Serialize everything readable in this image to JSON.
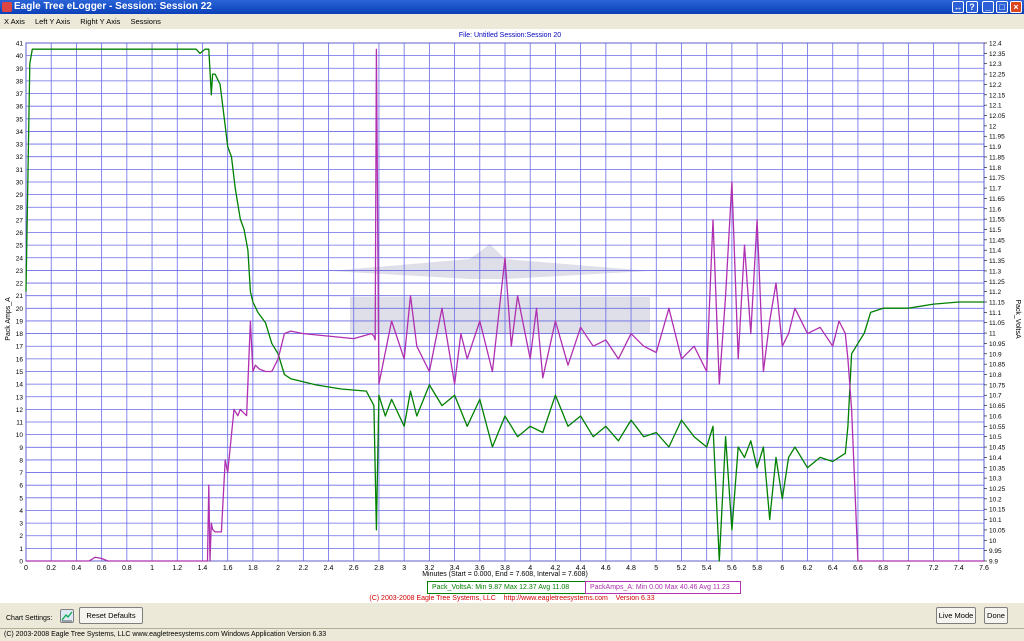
{
  "window": {
    "title": "Eagle Tree eLogger - Session: Session 22"
  },
  "menu": {
    "items": [
      {
        "label": "X Axis",
        "key": "X"
      },
      {
        "label": "Left Y Axis",
        "key": "L"
      },
      {
        "label": "Right Y Axis",
        "key": "R"
      },
      {
        "label": "Sessions",
        "key": ""
      }
    ]
  },
  "chart_header": {
    "file_line": "File: Untitled   Session:Session 20"
  },
  "footer": {
    "copyright": "(C) 2003-2008 Eagle Tree Systems, LLC",
    "url": "http://www.eagletreesystems.com",
    "version": "Version 6.33",
    "chart_settings_label": "Chart Settings:",
    "reset_label": "Reset Defaults",
    "live_mode_label": "Live Mode",
    "done_label": "Done",
    "status_text": "(C) 2003-2008 Eagle Tree Systems, LLC    www.eagletreesystems.com    Windows Application Version 6.33"
  },
  "colors": {
    "volts": "#008000",
    "amps": "#b030b0",
    "grid": "#6a6ae8",
    "title": "#0000c0",
    "footer_red": "#d00000"
  },
  "chart_data": {
    "type": "line",
    "title": "",
    "xlabel": "Minutes (Start = 0.000,  End = 7.608,  Interval = 7.608)",
    "ylabel_left": "Pack Amps_A",
    "ylabel_right": "Pack_VoltsA",
    "xlim": [
      0,
      7.6
    ],
    "ylim_left": [
      0,
      41
    ],
    "ylim_right": [
      9.9,
      12.4
    ],
    "x_ticks": [
      "0",
      "0.2",
      "0.4",
      "0.6",
      "0.8",
      "1",
      "1.2",
      "1.4",
      "1.6",
      "1.8",
      "2",
      "2.2",
      "2.4",
      "2.6",
      "2.8",
      "3",
      "3.2",
      "3.4",
      "3.6",
      "3.8",
      "4",
      "4.2",
      "4.4",
      "4.6",
      "4.8",
      "5",
      "5.2",
      "5.4",
      "5.6",
      "5.8",
      "6",
      "6.2",
      "6.4",
      "6.6",
      "6.8",
      "7",
      "7.2",
      "7.4",
      "7.6"
    ],
    "left_ticks": [
      "0",
      "1",
      "2",
      "3",
      "4",
      "5",
      "6",
      "7",
      "8",
      "9",
      "10",
      "11",
      "12",
      "13",
      "14",
      "15",
      "16",
      "17",
      "18",
      "19",
      "20",
      "21",
      "22",
      "23",
      "24",
      "25",
      "26",
      "27",
      "28",
      "29",
      "30",
      "31",
      "32",
      "33",
      "34",
      "35",
      "36",
      "37",
      "38",
      "39",
      "40",
      "41"
    ],
    "right_ticks": [
      "9.9",
      "9.95",
      "10",
      "10.05",
      "10.1",
      "10.15",
      "10.2",
      "10.25",
      "10.3",
      "10.35",
      "10.4",
      "10.45",
      "10.5",
      "10.55",
      "10.6",
      "10.65",
      "10.7",
      "10.75",
      "10.8",
      "10.85",
      "10.9",
      "10.95",
      "11",
      "11.05",
      "11.1",
      "11.15",
      "11.2",
      "11.25",
      "11.3",
      "11.35",
      "11.4",
      "11.45",
      "11.5",
      "11.55",
      "11.6",
      "11.65",
      "11.7",
      "11.75",
      "11.8",
      "11.85",
      "11.9",
      "11.95",
      "12",
      "12.05",
      "12.1",
      "12.15",
      "12.2",
      "12.25",
      "12.3",
      "12.35",
      "12.4"
    ],
    "legend": [
      {
        "text": "Pack_VoltsA:  Min 9.87   Max 12.37   Avg 11.08"
      },
      {
        "text": "PackAmps_A:  Min 0.00   Max 40.46   Avg 11.23"
      }
    ],
    "series": [
      {
        "name": "Pack_VoltsA",
        "axis": "right",
        "x": [
          0,
          0.03,
          0.05,
          0.3,
          0.8,
          1.2,
          1.35,
          1.38,
          1.42,
          1.45,
          1.47,
          1.48,
          1.5,
          1.54,
          1.58,
          1.6,
          1.63,
          1.66,
          1.7,
          1.73,
          1.76,
          1.78,
          1.8,
          1.84,
          1.9,
          1.95,
          2.0,
          2.05,
          2.1,
          2.3,
          2.5,
          2.7,
          2.76,
          2.78,
          2.8,
          2.85,
          2.9,
          3.0,
          3.05,
          3.1,
          3.2,
          3.3,
          3.4,
          3.5,
          3.6,
          3.7,
          3.8,
          3.9,
          4.0,
          4.1,
          4.2,
          4.3,
          4.4,
          4.5,
          4.6,
          4.7,
          4.8,
          4.9,
          5.0,
          5.1,
          5.2,
          5.3,
          5.4,
          5.45,
          5.5,
          5.55,
          5.6,
          5.65,
          5.7,
          5.75,
          5.8,
          5.85,
          5.9,
          5.95,
          6.0,
          6.05,
          6.1,
          6.2,
          6.3,
          6.4,
          6.5,
          6.52,
          6.55,
          6.6,
          6.65,
          6.7,
          6.8,
          7.0,
          7.2,
          7.4,
          7.6
        ],
        "y": [
          11.2,
          12.3,
          12.37,
          12.37,
          12.37,
          12.37,
          12.37,
          12.35,
          12.37,
          12.37,
          12.15,
          12.25,
          12.25,
          12.2,
          12.0,
          11.9,
          11.85,
          11.7,
          11.55,
          11.5,
          11.4,
          11.2,
          11.15,
          11.1,
          11.05,
          10.95,
          10.9,
          10.8,
          10.78,
          10.75,
          10.73,
          10.72,
          10.65,
          10.05,
          10.7,
          10.6,
          10.68,
          10.55,
          10.72,
          10.6,
          10.75,
          10.65,
          10.7,
          10.55,
          10.68,
          10.45,
          10.6,
          10.5,
          10.55,
          10.52,
          10.7,
          10.55,
          10.6,
          10.5,
          10.55,
          10.48,
          10.58,
          10.5,
          10.52,
          10.45,
          10.58,
          10.5,
          10.45,
          10.55,
          9.9,
          10.5,
          10.05,
          10.45,
          10.4,
          10.48,
          10.35,
          10.45,
          10.1,
          10.4,
          10.2,
          10.4,
          10.45,
          10.35,
          10.4,
          10.38,
          10.42,
          10.55,
          10.9,
          10.95,
          11.0,
          11.1,
          11.12,
          11.12,
          11.14,
          11.15,
          11.15
        ]
      },
      {
        "name": "PackAmps_A",
        "axis": "left",
        "x": [
          0,
          0.5,
          0.55,
          0.6,
          0.65,
          0.8,
          1.4,
          1.44,
          1.45,
          1.46,
          1.47,
          1.48,
          1.5,
          1.55,
          1.58,
          1.6,
          1.65,
          1.68,
          1.7,
          1.75,
          1.78,
          1.8,
          1.82,
          1.85,
          1.9,
          1.95,
          2.0,
          2.05,
          2.1,
          2.2,
          2.4,
          2.6,
          2.74,
          2.76,
          2.77,
          2.78,
          2.8,
          2.9,
          3.0,
          3.05,
          3.1,
          3.2,
          3.3,
          3.4,
          3.45,
          3.5,
          3.6,
          3.7,
          3.8,
          3.85,
          3.9,
          4.0,
          4.05,
          4.1,
          4.2,
          4.3,
          4.4,
          4.5,
          4.6,
          4.7,
          4.8,
          4.9,
          5.0,
          5.1,
          5.2,
          5.3,
          5.4,
          5.45,
          5.5,
          5.55,
          5.6,
          5.65,
          5.7,
          5.75,
          5.8,
          5.85,
          5.9,
          5.95,
          6.0,
          6.05,
          6.1,
          6.2,
          6.3,
          6.4,
          6.45,
          6.5,
          6.52,
          6.55,
          6.6,
          6.8,
          7.6
        ],
        "y": [
          0,
          0,
          0.3,
          0.2,
          0,
          0,
          0,
          0,
          6,
          0,
          3,
          2.5,
          2.3,
          2.3,
          8,
          7,
          12,
          11.5,
          12,
          11.5,
          19,
          15,
          15.5,
          15.2,
          15,
          15,
          16,
          18,
          18.2,
          18,
          17.8,
          17.6,
          18,
          17.8,
          17.5,
          40.5,
          14,
          19,
          16,
          21,
          17,
          15,
          20,
          14,
          18,
          16,
          19,
          15,
          24,
          17,
          21,
          16,
          20,
          14.5,
          19,
          15.5,
          18.5,
          17,
          17.5,
          16,
          18,
          17,
          16.5,
          20,
          16,
          17,
          15,
          27,
          14,
          21,
          30,
          16,
          25,
          18,
          27,
          15,
          19,
          22,
          17,
          18,
          20,
          18,
          18.5,
          17,
          19,
          18,
          16,
          12,
          0,
          0,
          0
        ]
      }
    ]
  }
}
